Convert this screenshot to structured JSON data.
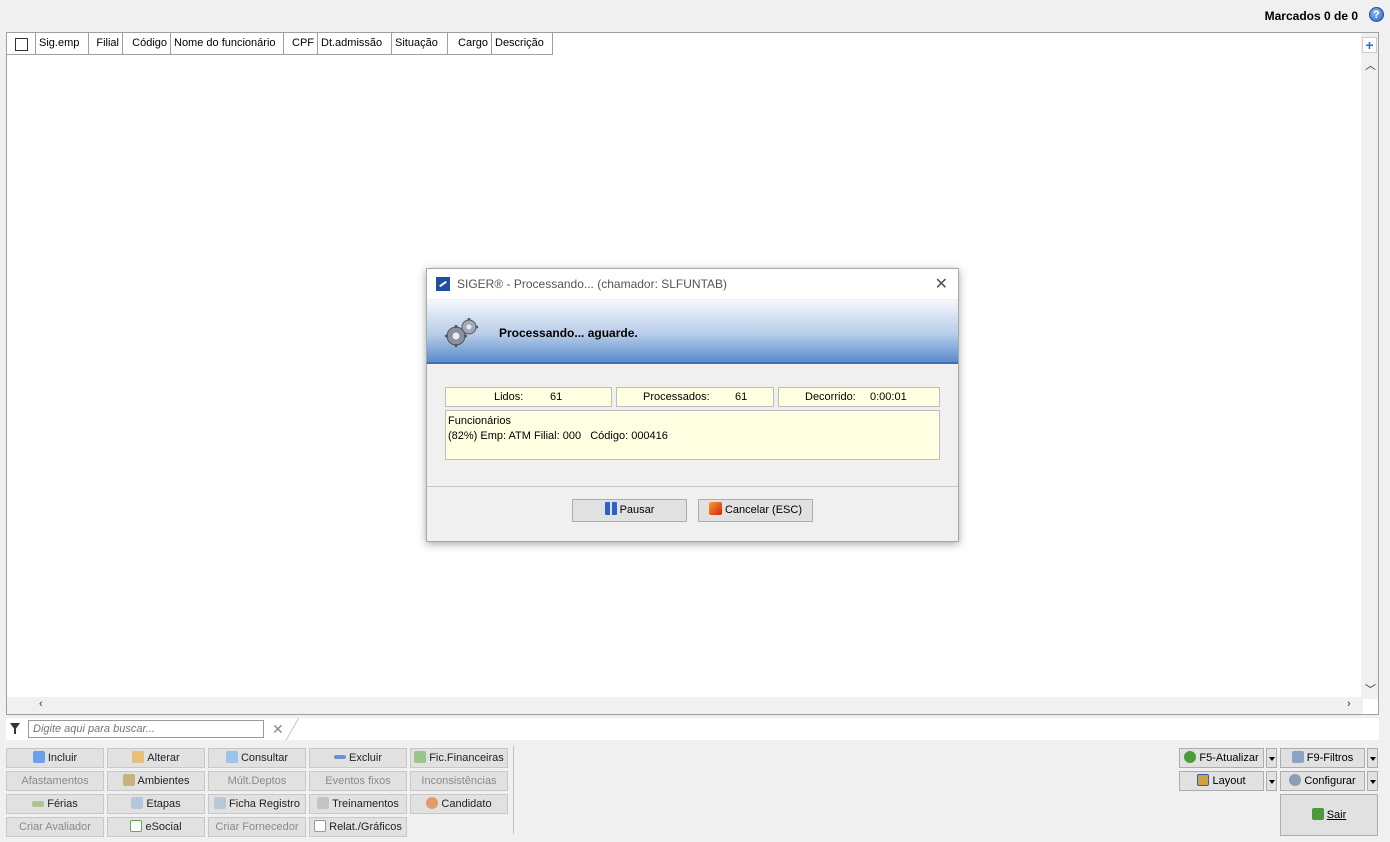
{
  "header": {
    "marcados": "Marcados 0 de 0",
    "help_icon": "?"
  },
  "grid": {
    "columns": [
      "Sig.emp",
      "Filial",
      "Código",
      "Nome do funcionário",
      "CPF",
      "Dt.admissão",
      "Situação",
      "Cargo",
      "Descrição"
    ],
    "add_icon": "+"
  },
  "search": {
    "placeholder": "Digite aqui para buscar...",
    "clear": "✕"
  },
  "buttons": {
    "incluir": "Incluir",
    "alterar": "Alterar",
    "consultar": "Consultar",
    "excluir": "Excluir",
    "fic_financeiras": "Fic.Financeiras",
    "afastamentos": "Afastamentos",
    "ambientes": "Ambientes",
    "mult_deptos": "Múlt.Deptos",
    "eventos_fixos": "Eventos fixos",
    "inconsistencias": "Inconsistências",
    "ferias": "Férias",
    "etapas": "Etapas",
    "ficha_registro": "Ficha Registro",
    "treinamentos": "Treinamentos",
    "candidato": "Candidato",
    "criar_avaliador": "Criar Avaliador",
    "esocial": "eSocial",
    "criar_fornecedor": "Criar Fornecedor",
    "relat_graficos": "Relat./Gráficos"
  },
  "right_buttons": {
    "atualizar": "F5-Atualizar",
    "filtros": "F9-Filtros",
    "layout": "Layout",
    "configurar": "Configurar",
    "sair": "Sair"
  },
  "dialog": {
    "title": "SIGER® - Processando... (chamador: SLFUNTAB)",
    "close": "✕",
    "banner": "Processando... aguarde.",
    "lidos_label": "Lidos:",
    "lidos_value": "61",
    "processados_label": "Processados:",
    "processados_value": "61",
    "decorrido_label": "Decorrido:",
    "decorrido_value": "0:00:01",
    "message_line1": "Funcionários",
    "message_line2": "(82%) Emp: ATM Filial: 000   Código: 000416",
    "pausar": "Pausar",
    "cancelar": "Cancelar (ESC)"
  }
}
